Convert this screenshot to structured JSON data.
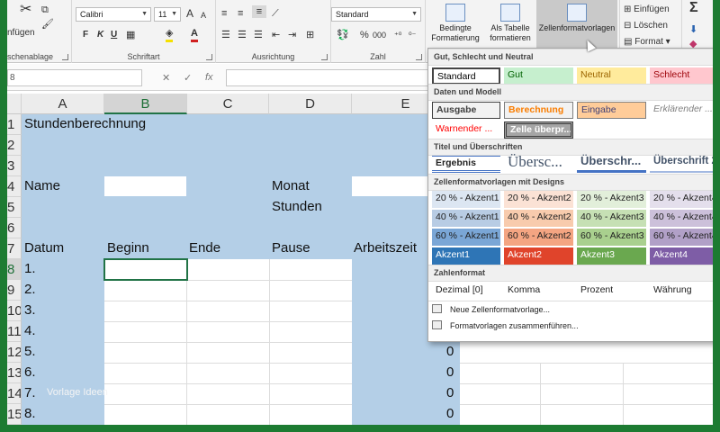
{
  "ribbon": {
    "clipboard_group": "schenablage",
    "paste_label": "nfügen",
    "font_group": "Schriftart",
    "font_name": "Calibri",
    "font_size": "11",
    "grow_label": "A",
    "shrink_label": "A",
    "bold": "F",
    "italic": "K",
    "underline": "U",
    "alignment_group": "Ausrichtung",
    "number_group": "Zahl",
    "number_format": "Standard",
    "percent": "%",
    "thousands": "000",
    "cond_format": "Bedingte Formatierung",
    "as_table": "Als Tabelle formatieren",
    "cell_styles": "Zellenformatvorlagen",
    "insert": "Einfügen",
    "delete": "Löschen",
    "format": "Format"
  },
  "formula_bar": {
    "name_box": "8",
    "cancel": "✕",
    "enter": "✓",
    "fx": "fx"
  },
  "grid": {
    "columns": [
      "A",
      "B",
      "C",
      "D",
      "E"
    ],
    "rows": [
      "1",
      "2",
      "3",
      "4",
      "5",
      "6",
      "7",
      "8",
      "9",
      "10",
      "11",
      "12",
      "13",
      "14",
      "15"
    ],
    "title": "Stundenberechnung",
    "name_label": "Name",
    "monat_label": "Monat",
    "stunden_label": "Stunden",
    "headers": [
      "Datum",
      "Beginn",
      "Ende",
      "Pause",
      "Arbeitszeit"
    ],
    "days": [
      "1.",
      "2.",
      "3.",
      "4.",
      "5.",
      "6.",
      "7.",
      "8."
    ],
    "zeros": [
      "0",
      "0",
      "0",
      "0"
    ],
    "watermark": "Vorlage Ideen"
  },
  "gallery": {
    "sections": [
      "Gut, Schlecht und Neutral",
      "Daten und Modell",
      "Titel und Überschriften",
      "Zellenformatvorlagen mit Designs",
      "Zahlenformat"
    ],
    "good_bad": [
      "Standard",
      "Gut",
      "Neutral",
      "Schlecht"
    ],
    "data_model": [
      "Ausgabe",
      "Berechnung",
      "Eingabe",
      "Erklärender ...",
      "Warnender ...",
      "Zelle überpr..."
    ],
    "titles": [
      "Ergebnis",
      "Übersc...",
      "Überschr...",
      "Überschrift 2"
    ],
    "accent20": [
      "20 % - Akzent1",
      "20 % - Akzent2",
      "20 % - Akzent3",
      "20 % - Akzent4"
    ],
    "accent40": [
      "40 % - Akzent1",
      "40 % - Akzent2",
      "40 % - Akzent3",
      "40 % - Akzent4"
    ],
    "accent60": [
      "60 % - Akzent1",
      "60 % - Akzent2",
      "60 % - Akzent3",
      "60 % - Akzent4"
    ],
    "accent": [
      "Akzent1",
      "Akzent2",
      "Akzent3",
      "Akzent4"
    ],
    "number": [
      "Dezimal [0]",
      "Komma",
      "Prozent",
      "Währung"
    ],
    "new_style": "Neue Zellenformatvorlage...",
    "merge_styles": "Formatvorlagen zusammenführen..."
  },
  "colors": {
    "excel_green": "#217346",
    "border_green": "#1d7b32",
    "cell_blue": "#b4cfe7"
  }
}
